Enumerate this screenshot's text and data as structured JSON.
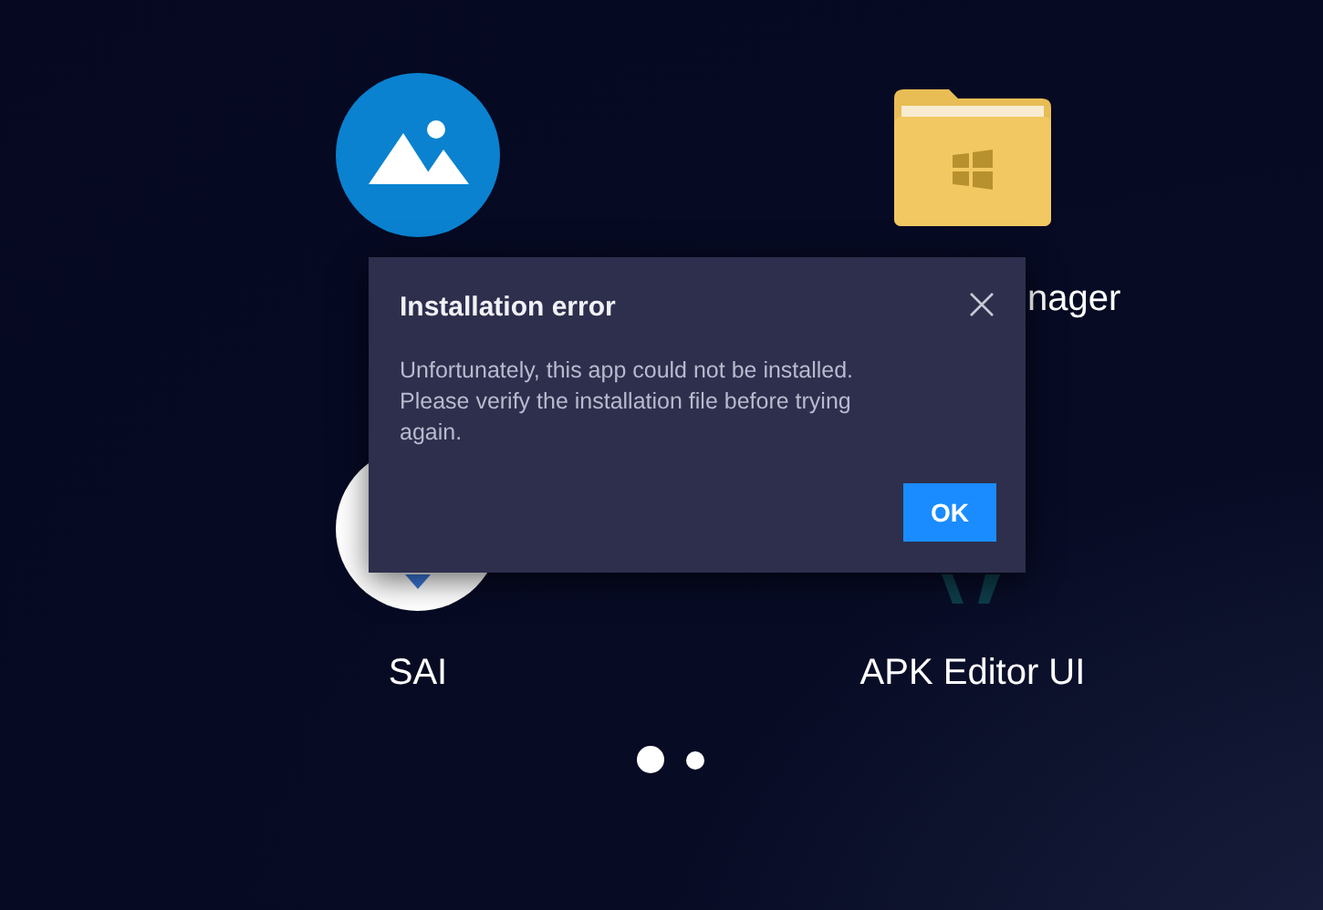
{
  "apps": [
    {
      "kind": "gallery"
    },
    {
      "kind": "folder",
      "label": "nager"
    },
    {
      "kind": "sai",
      "label": "SAI"
    },
    {
      "kind": "apk-editor",
      "label": "APK Editor UI"
    }
  ],
  "page_dots": [
    {
      "selected": true
    },
    {
      "selected": false
    }
  ],
  "dialog": {
    "title": "Installation error",
    "message": "Unfortunately, this app could not be installed. Please verify the installation file before trying again.",
    "button": "OK"
  }
}
